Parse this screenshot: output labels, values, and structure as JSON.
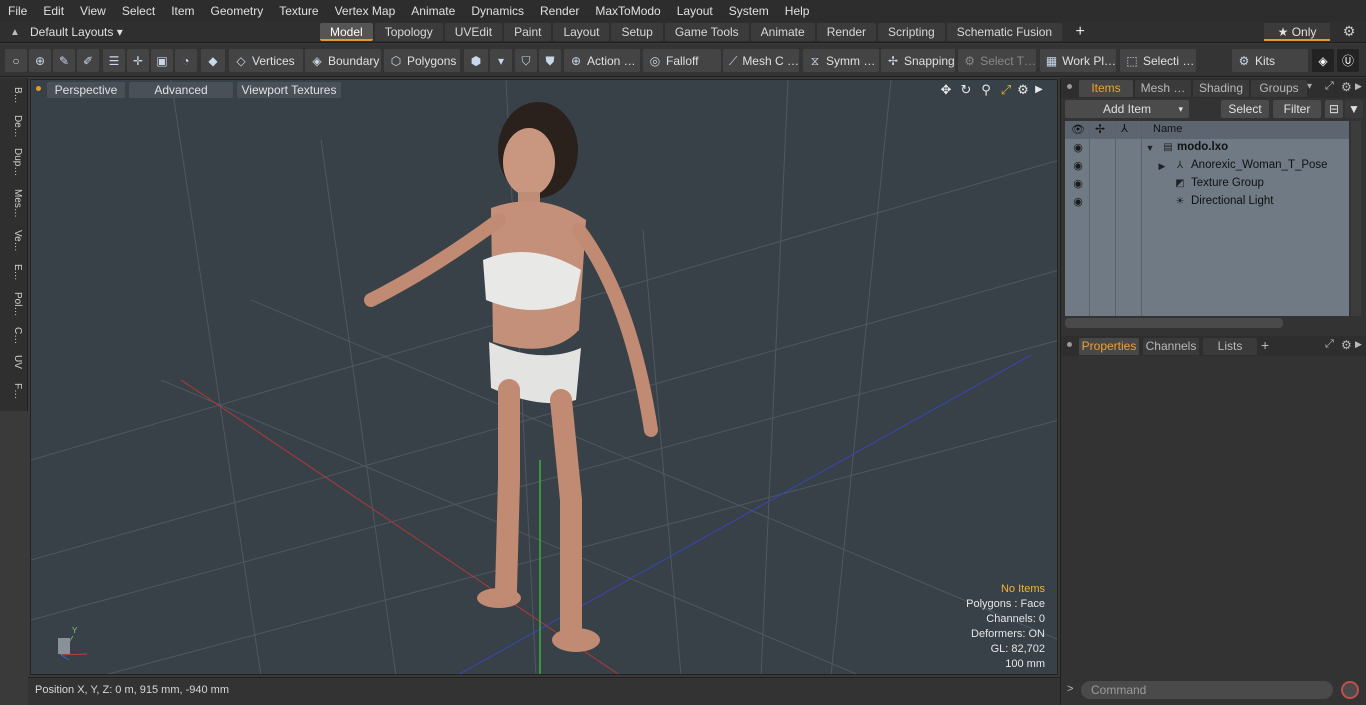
{
  "menu": [
    "File",
    "Edit",
    "View",
    "Select",
    "Item",
    "Geometry",
    "Texture",
    "Vertex Map",
    "Animate",
    "Dynamics",
    "Render",
    "MaxToModo",
    "Layout",
    "System",
    "Help"
  ],
  "layoutbar": {
    "layout_select": "Default Layouts ▾",
    "tabs": [
      "Model",
      "Topology",
      "UVEdit",
      "Paint",
      "Layout",
      "Setup",
      "Game Tools",
      "Animate",
      "Render",
      "Scripting",
      "Schematic Fusion"
    ],
    "active_tab": "Model",
    "plus": "+",
    "only_label": "★  Only"
  },
  "toolbar": {
    "vertices": "Vertices",
    "boundary": "Boundary",
    "polygons": "Polygons",
    "action": "Action  …",
    "falloff": "Falloff",
    "mesh_c": "Mesh C …",
    "symm": "Symm …",
    "snapping": "Snapping",
    "select_t": "Select T…",
    "work_pl": "Work Pl…",
    "selecti": "Selecti …",
    "kits": "Kits"
  },
  "left_tabs": [
    "B…",
    "De…",
    "Dup…",
    "Mes…",
    "Ve…",
    "E…",
    "Pol…",
    "C…",
    "UV",
    "F…"
  ],
  "viewport": {
    "perspective": "Perspective",
    "advanced": "Advanced",
    "viewport_textures": "Viewport Textures",
    "info": {
      "no_items": "No Items",
      "polygons": "Polygons : Face",
      "channels": "Channels: 0",
      "deformers": "Deformers: ON",
      "gl": "GL: 82,702",
      "scale": "100 mm"
    },
    "axis_y": "Y"
  },
  "status": {
    "position": "Position X, Y, Z:   0 m, 915 mm, -940 mm"
  },
  "items_panel": {
    "tabs": [
      "Items",
      "Mesh …",
      "Shading",
      "Groups"
    ],
    "active_tab": "Items",
    "add_item": "Add Item",
    "select": "Select",
    "filter": "Filter",
    "name_header": "Name",
    "rows": [
      {
        "label": "modo.lxo"
      },
      {
        "label": "Anorexic_Woman_T_Pose"
      },
      {
        "label": "Texture Group"
      },
      {
        "label": "Directional Light"
      }
    ]
  },
  "properties_panel": {
    "tabs": [
      "Properties",
      "Channels",
      "Lists"
    ],
    "active_tab": "Properties",
    "plus": "+"
  },
  "command": {
    "prompt": ">",
    "placeholder": "Command"
  },
  "colors": {
    "accent": "#e39b2b",
    "viewport_bg": "#384048",
    "panel_bg": "#333333",
    "list_bg": "#6f7a85"
  }
}
